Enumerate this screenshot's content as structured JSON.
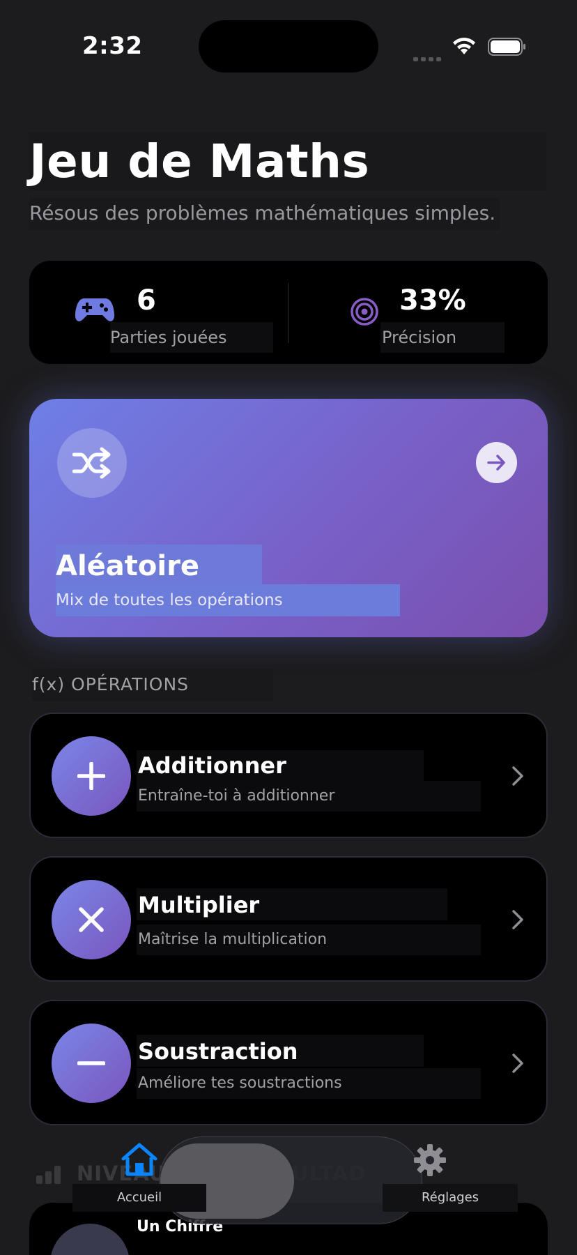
{
  "status_bar": {
    "time": "2:32"
  },
  "header": {
    "title": "Jeu de Maths",
    "subtitle": "Résous des problèmes mathématiques simples."
  },
  "stats": {
    "games_played": {
      "value": "6",
      "label": "Parties jouées",
      "icon": "gamecontroller-icon"
    },
    "accuracy": {
      "value": "33%",
      "label": "Précision",
      "icon": "target-icon"
    }
  },
  "random_card": {
    "title": "Aléatoire",
    "subtitle": "Mix de toutes les opérations",
    "icon": "shuffle-icon"
  },
  "operations_section": {
    "label": "f(x) OPÉRATIONS",
    "items": [
      {
        "title": "Additionner",
        "subtitle": "Entraîne-toi à additionner",
        "icon": "plus-icon"
      },
      {
        "title": "Multiplier",
        "subtitle": "Maîtrise la multiplication",
        "icon": "multiply-icon"
      },
      {
        "title": "Soustraction",
        "subtitle": "Améliore tes soustractions",
        "icon": "minus-icon"
      }
    ]
  },
  "level_section": {
    "label": "NIVEAU DE DIFFICULTAD",
    "first_item_title": "Un Chiffre"
  },
  "tab_bar": {
    "home_label": "Accueil",
    "settings_label": "Réglages"
  },
  "colors": {
    "background": "#1c1c1e",
    "accent_blue": "#0a84ff",
    "gradient_start": "#6e7fe6",
    "gradient_end": "#7a4fae",
    "purple": "#7a56bf"
  }
}
